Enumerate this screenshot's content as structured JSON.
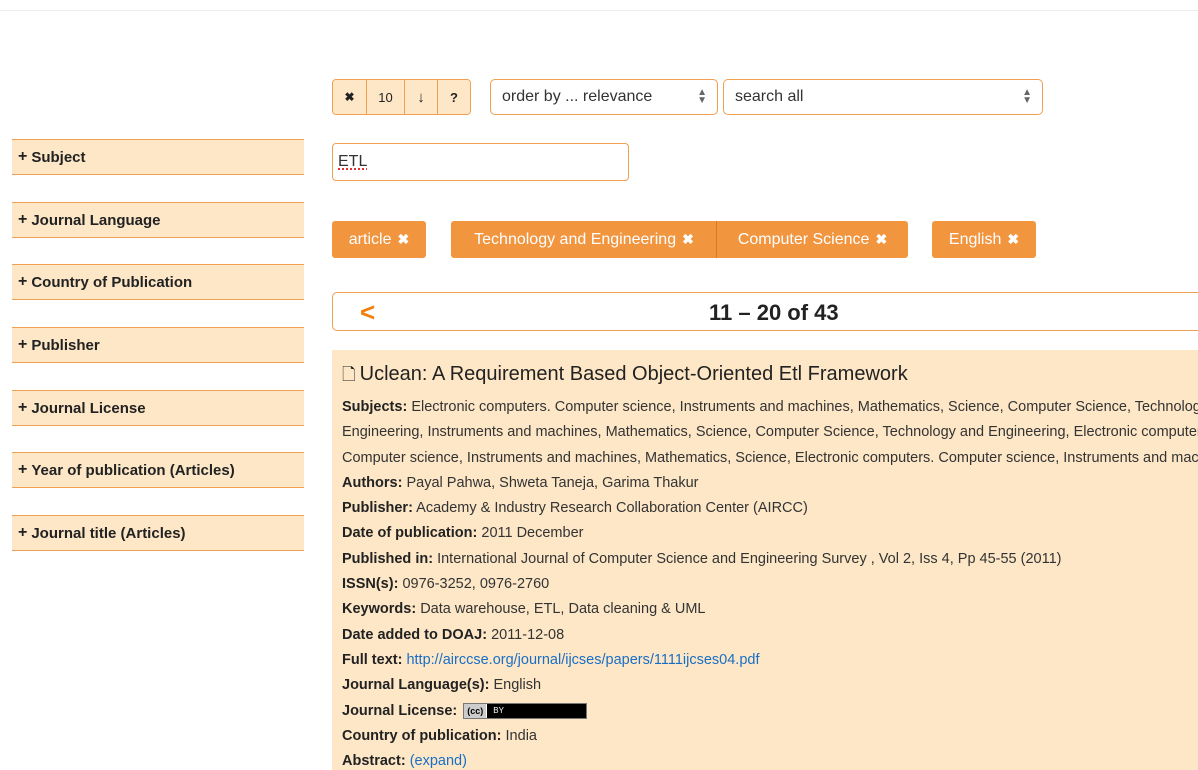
{
  "sidebar": {
    "facets": [
      {
        "label": "Subject"
      },
      {
        "label": "Journal Language"
      },
      {
        "label": "Country of Publication"
      },
      {
        "label": "Publisher"
      },
      {
        "label": "Journal License"
      },
      {
        "label": "Year of publication (Articles)"
      },
      {
        "label": "Journal title (Articles)"
      }
    ]
  },
  "toolbar": {
    "clear_label": "✖",
    "page_size": "10",
    "sort_dir_label": "↓",
    "help_label": "?",
    "order_by": "order by ... relevance",
    "search_field": "search all"
  },
  "search": {
    "value": "ETL"
  },
  "filters": [
    {
      "label": "article"
    },
    {
      "label": "Technology and Engineering"
    },
    {
      "label": "Computer Science"
    },
    {
      "label": "English"
    }
  ],
  "filter_remove_glyph": "✖",
  "pager": {
    "prev_label": "<",
    "range": "11 – 20 of 43"
  },
  "result": {
    "title": "Uclean: A Requirement Based Object-Oriented Etl Framework",
    "fields": {
      "subjects_label": "Subjects",
      "subjects_value": "Electronic computers. Computer science, Instruments and machines, Mathematics, Science, Computer Science, Technology and Engineering, Instruments and machines, Mathematics, Science, Computer Science, Technology and Engineering, Electronic computers. Computer science, Instruments and machines, Mathematics, Science, Electronic computers. Computer science, Instruments and machines",
      "authors_label": "Authors",
      "authors_value": "Payal Pahwa, Shweta Taneja, Garima Thakur",
      "publisher_label": "Publisher",
      "publisher_value": "Academy & Industry Research Collaboration Center (AIRCC)",
      "date_label": "Date of publication",
      "date_value": "2011 December",
      "published_in_label": "Published in",
      "published_in_value": "International Journal of Computer Science and Engineering Survey , Vol 2, Iss 4, Pp 45-55 (2011)",
      "issn_label": "ISSN(s)",
      "issn_value": "0976-3252, 0976-2760",
      "keywords_label": "Keywords",
      "keywords_value": "Data warehouse, ETL, Data cleaning & UML",
      "date_added_label": "Date added to DOAJ",
      "date_added_value": "2011-12-08",
      "fulltext_label": "Full text",
      "fulltext_value": "http://airccse.org/journal/ijcses/papers/1111ijcses04.pdf",
      "language_label": "Journal Language(s)",
      "language_value": "English",
      "license_label": "Journal License",
      "license_badge_cc": "(cc)",
      "license_badge_by": "BY",
      "country_label": "Country of publication",
      "country_value": "India",
      "abstract_label": "Abstract",
      "abstract_expand": "(expand)"
    }
  },
  "colors": {
    "accent": "#f1953f",
    "panel": "#fde7c7",
    "border": "#f0a050",
    "link": "#1a6fc4"
  }
}
